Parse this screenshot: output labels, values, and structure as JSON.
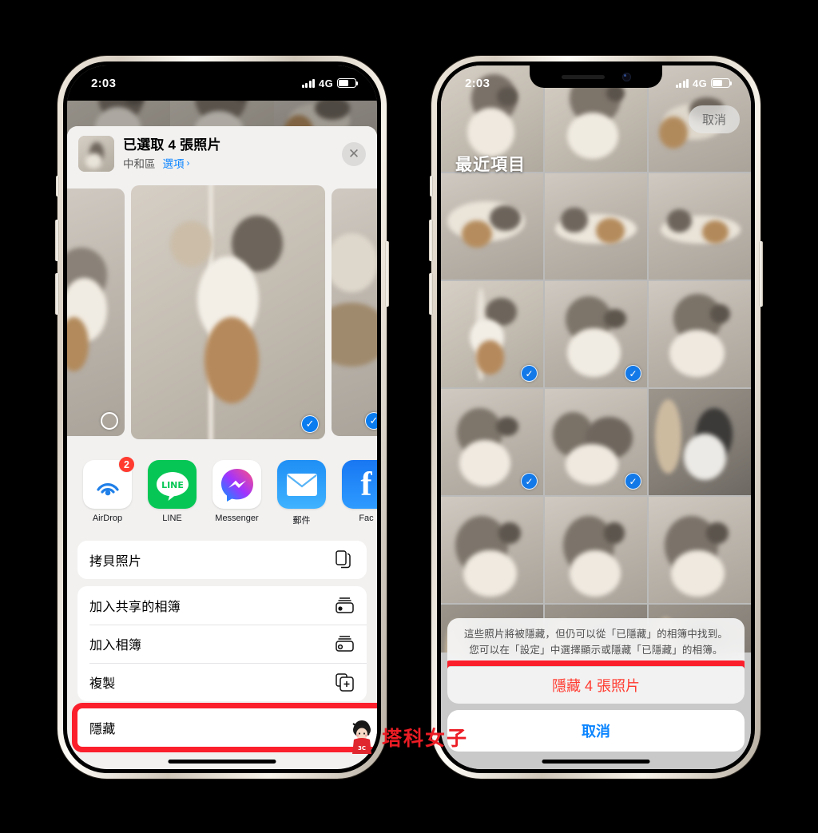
{
  "left_phone": {
    "status_bar": {
      "time": "2:03",
      "network": "4G",
      "signal_icon": "signal-bars-icon",
      "battery_icon": "battery-icon"
    },
    "share_sheet": {
      "title": "已選取 4 張照片",
      "subtitle_location": "中和區",
      "subtitle_options": "選項",
      "chevron": "›",
      "close_label": "✕",
      "carousel": [
        {
          "selected": false,
          "size": "small"
        },
        {
          "selected": true,
          "size": "big"
        },
        {
          "selected": true,
          "size": "small"
        }
      ],
      "apps": [
        {
          "label": "AirDrop",
          "icon": "airdrop-icon",
          "badge": "2"
        },
        {
          "label": "LINE",
          "icon": "line-icon",
          "badge": ""
        },
        {
          "label": "Messenger",
          "icon": "messenger-icon",
          "badge": ""
        },
        {
          "label": "郵件",
          "icon": "mail-icon",
          "badge": ""
        },
        {
          "label": "Fac",
          "icon": "facebook-icon",
          "badge": ""
        }
      ],
      "actions_group_1": [
        {
          "label": "拷貝照片",
          "icon": "copy-photos-icon"
        }
      ],
      "actions_group_2": [
        {
          "label": "加入共享的相簿",
          "icon": "shared-album-icon"
        },
        {
          "label": "加入相簿",
          "icon": "add-to-album-icon"
        },
        {
          "label": "複製",
          "icon": "duplicate-icon"
        }
      ],
      "actions_group_3": [
        {
          "label": "隱藏",
          "icon": "",
          "highlighted": true
        }
      ]
    }
  },
  "right_phone": {
    "status_bar": {
      "time": "2:03",
      "network": "4G",
      "signal_icon": "signal-bars-icon",
      "battery_icon": "battery-icon"
    },
    "album_title": "最近項目",
    "cancel_label": "取消",
    "grid_selected_indices": [
      6,
      7,
      9,
      10
    ],
    "grid_cell_count": 18,
    "action_sheet": {
      "message": "這些照片將被隱藏，但仍可以從「已隱藏」的相簿中找到。您可以在「設定」中選擇顯示或隱藏「已隱藏」的相簿。",
      "destructive_label": "隱藏 4 張照片",
      "destructive_highlighted": true,
      "cancel_label": "取消"
    }
  },
  "watermark": {
    "text": "塔科女子",
    "shirt_text": "3C"
  },
  "colors": {
    "highlight_red": "#fb1f2c",
    "destructive_red": "#ff3b30",
    "ios_blue": "#0a84ff",
    "selection_blue": "#1379e8",
    "sheet_bg": "#f2f1f0"
  }
}
